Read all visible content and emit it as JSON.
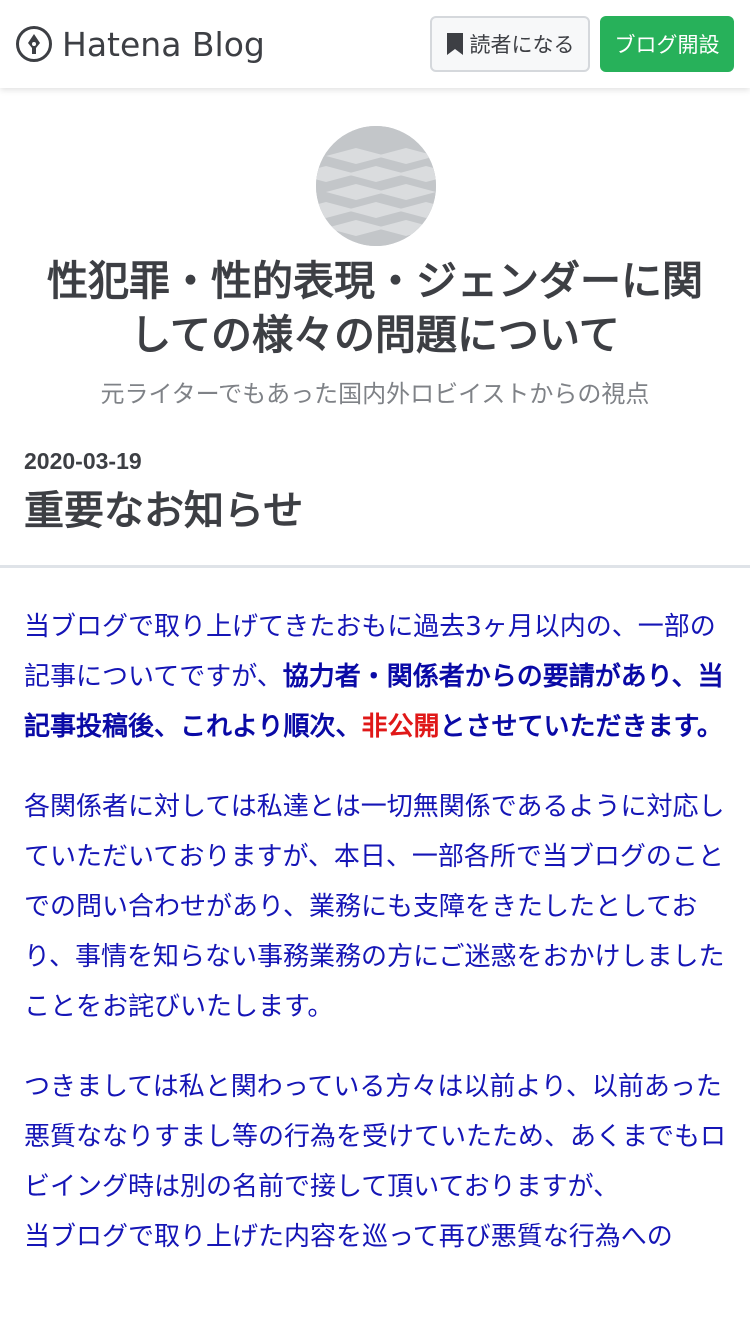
{
  "header": {
    "logo_text": "Hatena Blog",
    "subscribe_label": "読者になる",
    "open_blog_label": "ブログ開設",
    "accent_color": "#27b15a"
  },
  "blog": {
    "title_line1": "性犯罪・性的表現・ジェンダーに関",
    "title_line2": "しての様々の問題について",
    "description": "元ライターでもあった国内外ロビイストからの視点"
  },
  "entry": {
    "date": "2020-03-19",
    "title": "重要なお知らせ",
    "p1_a": "当ブログで取り上げてきたおもに過去3ヶ月以内の、一部の記事についてですが、",
    "p1_b": "協力者・関係者からの要請があり、当記事投稿後、これより順次、",
    "p1_c": "非公開",
    "p1_d": "とさせていただきます。",
    "p2": "各関係者に対しては私達とは一切無関係であるように対応していただいておりますが、本日、一部各所で当ブログのことでの問い合わせがあり、業務にも支障をきたしたとしており、事情を知らない事務業務の方にご迷惑をおかけしましたことをお詫びいたします。",
    "p3": "つきましては私と関わっている方々は以前より、以前あった悪質ななりすまし等の行為を受けていたため、あくまでもロビイング時は別の名前で接して頂いておりますが、",
    "p4": "当ブログで取り上げた内容を巡って再び悪質な行為への"
  }
}
